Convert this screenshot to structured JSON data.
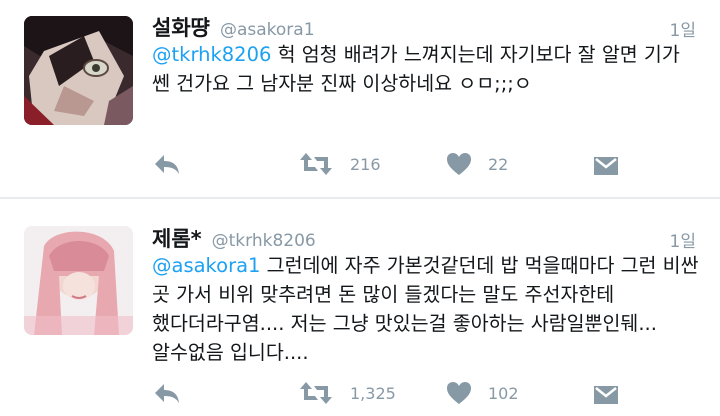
{
  "tweets": [
    {
      "author": "설화땽",
      "handle": "@asakora1",
      "time": "1일",
      "mention": "@tkrhk8206",
      "text": " 헉 엄청 배려가 느껴지는데 자기보다 잘 알면 기가 쎈 건가요 그 남자분 진짜 이상하네요 ㅇㅁ;;;ㅇ",
      "retweets": "216",
      "likes": "22",
      "avatar": "anime-character-avatar"
    },
    {
      "author": "제롬*",
      "handle": "@tkrhk8206",
      "time": "1일",
      "mention": "@asakora1",
      "text": " 그런데에 자주 가본것같던데 밥 먹을때마다 그런 비싼 곳 가서 비위 맞추려면 돈 많이 들겠다는 말도 주선자한테 했다더라구염.... 저는 그냥 맛있는걸 좋아하는 사람일뿐인뒈... 알수없음 입니다....",
      "retweets": "1,325",
      "likes": "102",
      "avatar": "pink-hair-avatar"
    }
  ],
  "icons": {
    "reply": "reply-icon",
    "retweet": "retweet-icon",
    "like": "heart-icon",
    "message": "direct-message-icon"
  },
  "colors": {
    "mention": "#1da1f2",
    "muted": "#8899a6",
    "divider": "#e6ecf0"
  }
}
